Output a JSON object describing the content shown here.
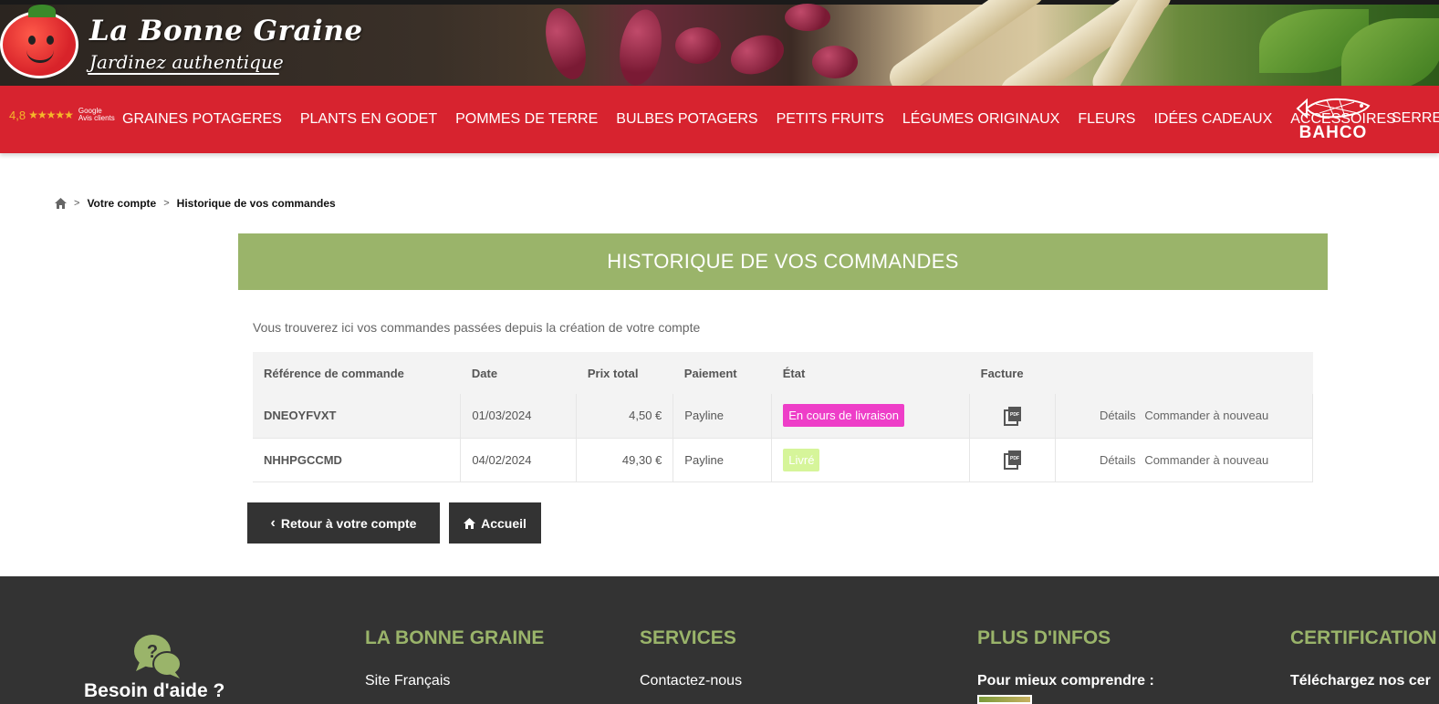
{
  "brand": {
    "title": "La Bonne Graine",
    "tagline": "Jardinez authentique"
  },
  "rating": {
    "score": "4,8",
    "stars": "★★★★★",
    "badge_line1": "Google",
    "badge_line2": "Avis clients"
  },
  "nav": {
    "items": [
      {
        "label": "GRAINES POTAGERES"
      },
      {
        "label": "PLANTS EN GODET"
      },
      {
        "label": "POMMES DE TERRE"
      },
      {
        "label": "BULBES POTAGERS"
      },
      {
        "label": "PETITS FRUITS"
      },
      {
        "label": "LÉGUMES ORIGINAUX"
      },
      {
        "label": "FLEURS"
      },
      {
        "label": "IDÉES CADEAUX"
      },
      {
        "label": "ACCESSOIRES"
      }
    ],
    "partner_logo": "BAHCO",
    "overflow_item": "SERRE"
  },
  "breadcrumb": {
    "icon": "home-icon",
    "sep": ">",
    "items": [
      "Votre compte",
      "Historique de vos commandes"
    ]
  },
  "page": {
    "title": "HISTORIQUE DE VOS COMMANDES",
    "intro": "Vous trouverez ici vos commandes passées depuis la création de votre compte"
  },
  "table": {
    "headers": [
      "Référence de commande",
      "Date",
      "Prix total",
      "Paiement",
      "État",
      "Facture",
      ""
    ],
    "rows": [
      {
        "ref": "DNEOYFVXT",
        "date": "01/03/2024",
        "price": "4,50 €",
        "payment": "Payline",
        "status": "En cours de livraison",
        "status_color": "#ee3ec8",
        "details": "Détails",
        "reorder": "Commander à nouveau"
      },
      {
        "ref": "NHHPGCCMD",
        "date": "04/02/2024",
        "price": "49,30 €",
        "payment": "Payline",
        "status": "Livré",
        "status_color": "#d6f59a",
        "details": "Détails",
        "reorder": "Commander à nouveau"
      }
    ]
  },
  "buttons": {
    "back": "Retour à votre compte",
    "home": "Accueil"
  },
  "footer": {
    "help_title": "Besoin d'aide ?",
    "columns": [
      {
        "title": "LA BONNE GRAINE",
        "first_line": "Site Français"
      },
      {
        "title": "SERVICES",
        "first_line": "Contactez-nous"
      },
      {
        "title": "PLUS D'INFOS",
        "first_line": "Pour mieux comprendre :"
      },
      {
        "title": "CERTIFICATION",
        "first_line": "Téléchargez nos cer"
      }
    ]
  },
  "colors": {
    "nav_red": "#d7232f",
    "title_green": "#9ab46a",
    "footer_dark": "#333333",
    "button_dark": "#333333"
  }
}
